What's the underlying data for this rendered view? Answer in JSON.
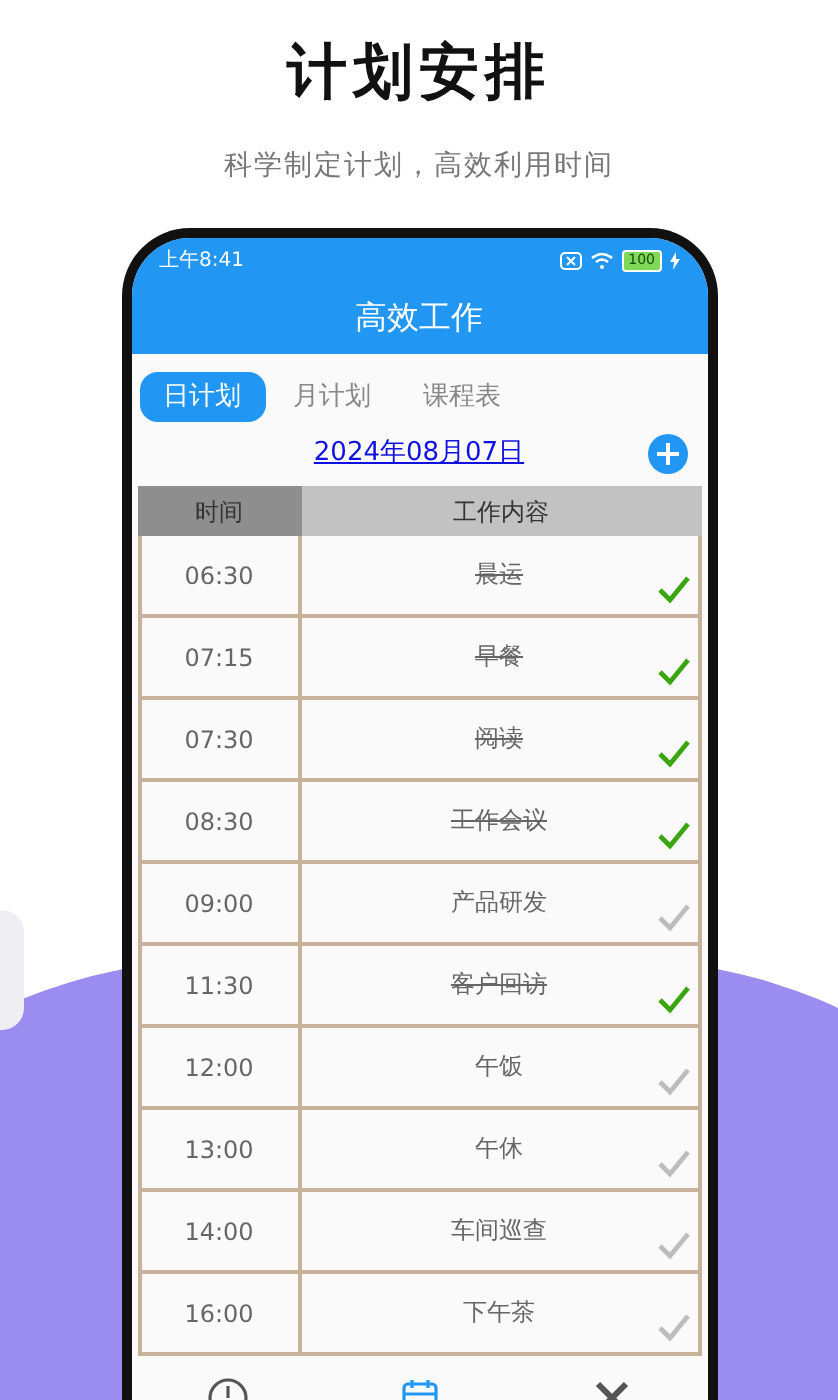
{
  "headline": "计划安排",
  "subtitle": "科学制定计划，高效利用时间",
  "status_bar": {
    "time": "上午8:41",
    "battery": "100"
  },
  "app_title": "高效工作",
  "tabs": [
    {
      "label": "日计划",
      "selected": true
    },
    {
      "label": "月计划",
      "selected": false
    },
    {
      "label": "课程表",
      "selected": false
    }
  ],
  "date": "2024年08月07日",
  "table": {
    "columns": [
      "时间",
      "工作内容"
    ],
    "rows": [
      {
        "time": "06:30",
        "task": "晨运",
        "done": true
      },
      {
        "time": "07:15",
        "task": "早餐",
        "done": true
      },
      {
        "time": "07:30",
        "task": "阅读",
        "done": true
      },
      {
        "time": "08:30",
        "task": "工作会议",
        "done": true
      },
      {
        "time": "09:00",
        "task": "产品研发",
        "done": false
      },
      {
        "time": "11:30",
        "task": "客户回访",
        "done": true
      },
      {
        "time": "12:00",
        "task": "午饭",
        "done": false
      },
      {
        "time": "13:00",
        "task": "午休",
        "done": false
      },
      {
        "time": "14:00",
        "task": "车间巡查",
        "done": false
      },
      {
        "time": "16:00",
        "task": "下午茶",
        "done": false
      }
    ]
  },
  "bottom_nav": [
    {
      "kind": "clock",
      "selected": false
    },
    {
      "kind": "calendar",
      "selected": true
    },
    {
      "kind": "tools",
      "selected": false
    }
  ]
}
